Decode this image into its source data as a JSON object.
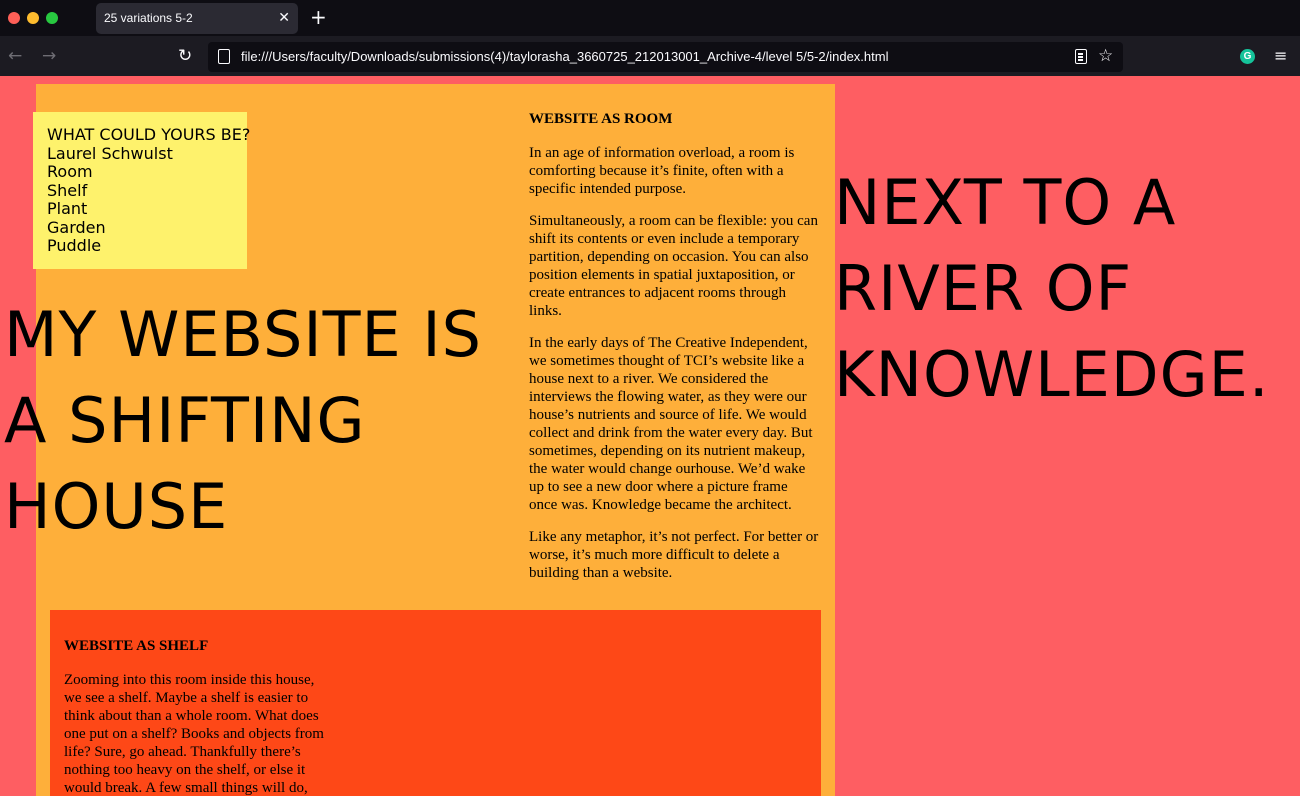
{
  "browser": {
    "tab_title": "25 variations 5-2",
    "tab_close": "✕",
    "new_tab": "+",
    "back": "←",
    "forward": "→",
    "reload": "↻",
    "url": "file:///Users/faculty/Downloads/submissions(4)/taylorasha_3660725_212013001_Archive-4/level 5/5-2/index.html",
    "star": "☆",
    "extension": "G",
    "menu": "≡"
  },
  "nav": {
    "heading": "WHAT COULD YOURS BE?",
    "items": [
      "Laurel Schwulst",
      "Room",
      "Shelf",
      "Plant",
      "Garden",
      "Puddle"
    ]
  },
  "headline_main": [
    "MY WEBSITE IS",
    "A SHIFTING",
    "HOUSE"
  ],
  "headline_side": [
    "NEXT TO A",
    "RIVER OF",
    "KNOWLEDGE."
  ],
  "room": {
    "title": "WEBSITE AS ROOM",
    "paragraphs": [
      "In an age of information overload, a room is comforting because it’s finite, often with a specific intended purpose.",
      "Simultaneously, a room can be flexible: you can shift its contents or even include a temporary partition, depending on occasion. You can also position elements in spatial juxtaposition, or create entrances to adjacent rooms through links.",
      "In the early days of The Creative Independent, we sometimes thought of TCI’s website like a house next to a river. We considered the interviews the flowing water, as they were our house’s nutrients and source of life. We would collect and drink from the water every day. But sometimes, depending on its nutrient makeup, the water would change ourhouse. We’d wake up to see a new door where a picture frame once was. Knowledge became the architect.",
      "Like any metaphor, it’s not perfect. For better or worse, it’s much more difficult to delete a building than a website."
    ]
  },
  "shelf": {
    "title": "WEBSITE AS SHELF",
    "paragraphs": [
      "Zooming into this room inside this house, we see a shelf. Maybe a shelf is easier to think about than a whole room. What does one put on a shelf? Books and objects from life? Sure, go ahead. Thankfully there’s nothing too heavy on the shelf, or else it would break. A few small things will do,"
    ]
  },
  "colors": {
    "page_bg": "#fe5e62",
    "room_bg": "#feaf3a",
    "shelf_bg": "#fe4817",
    "nav_bg": "#fef26c",
    "chrome_bg": "#1c1b22"
  }
}
